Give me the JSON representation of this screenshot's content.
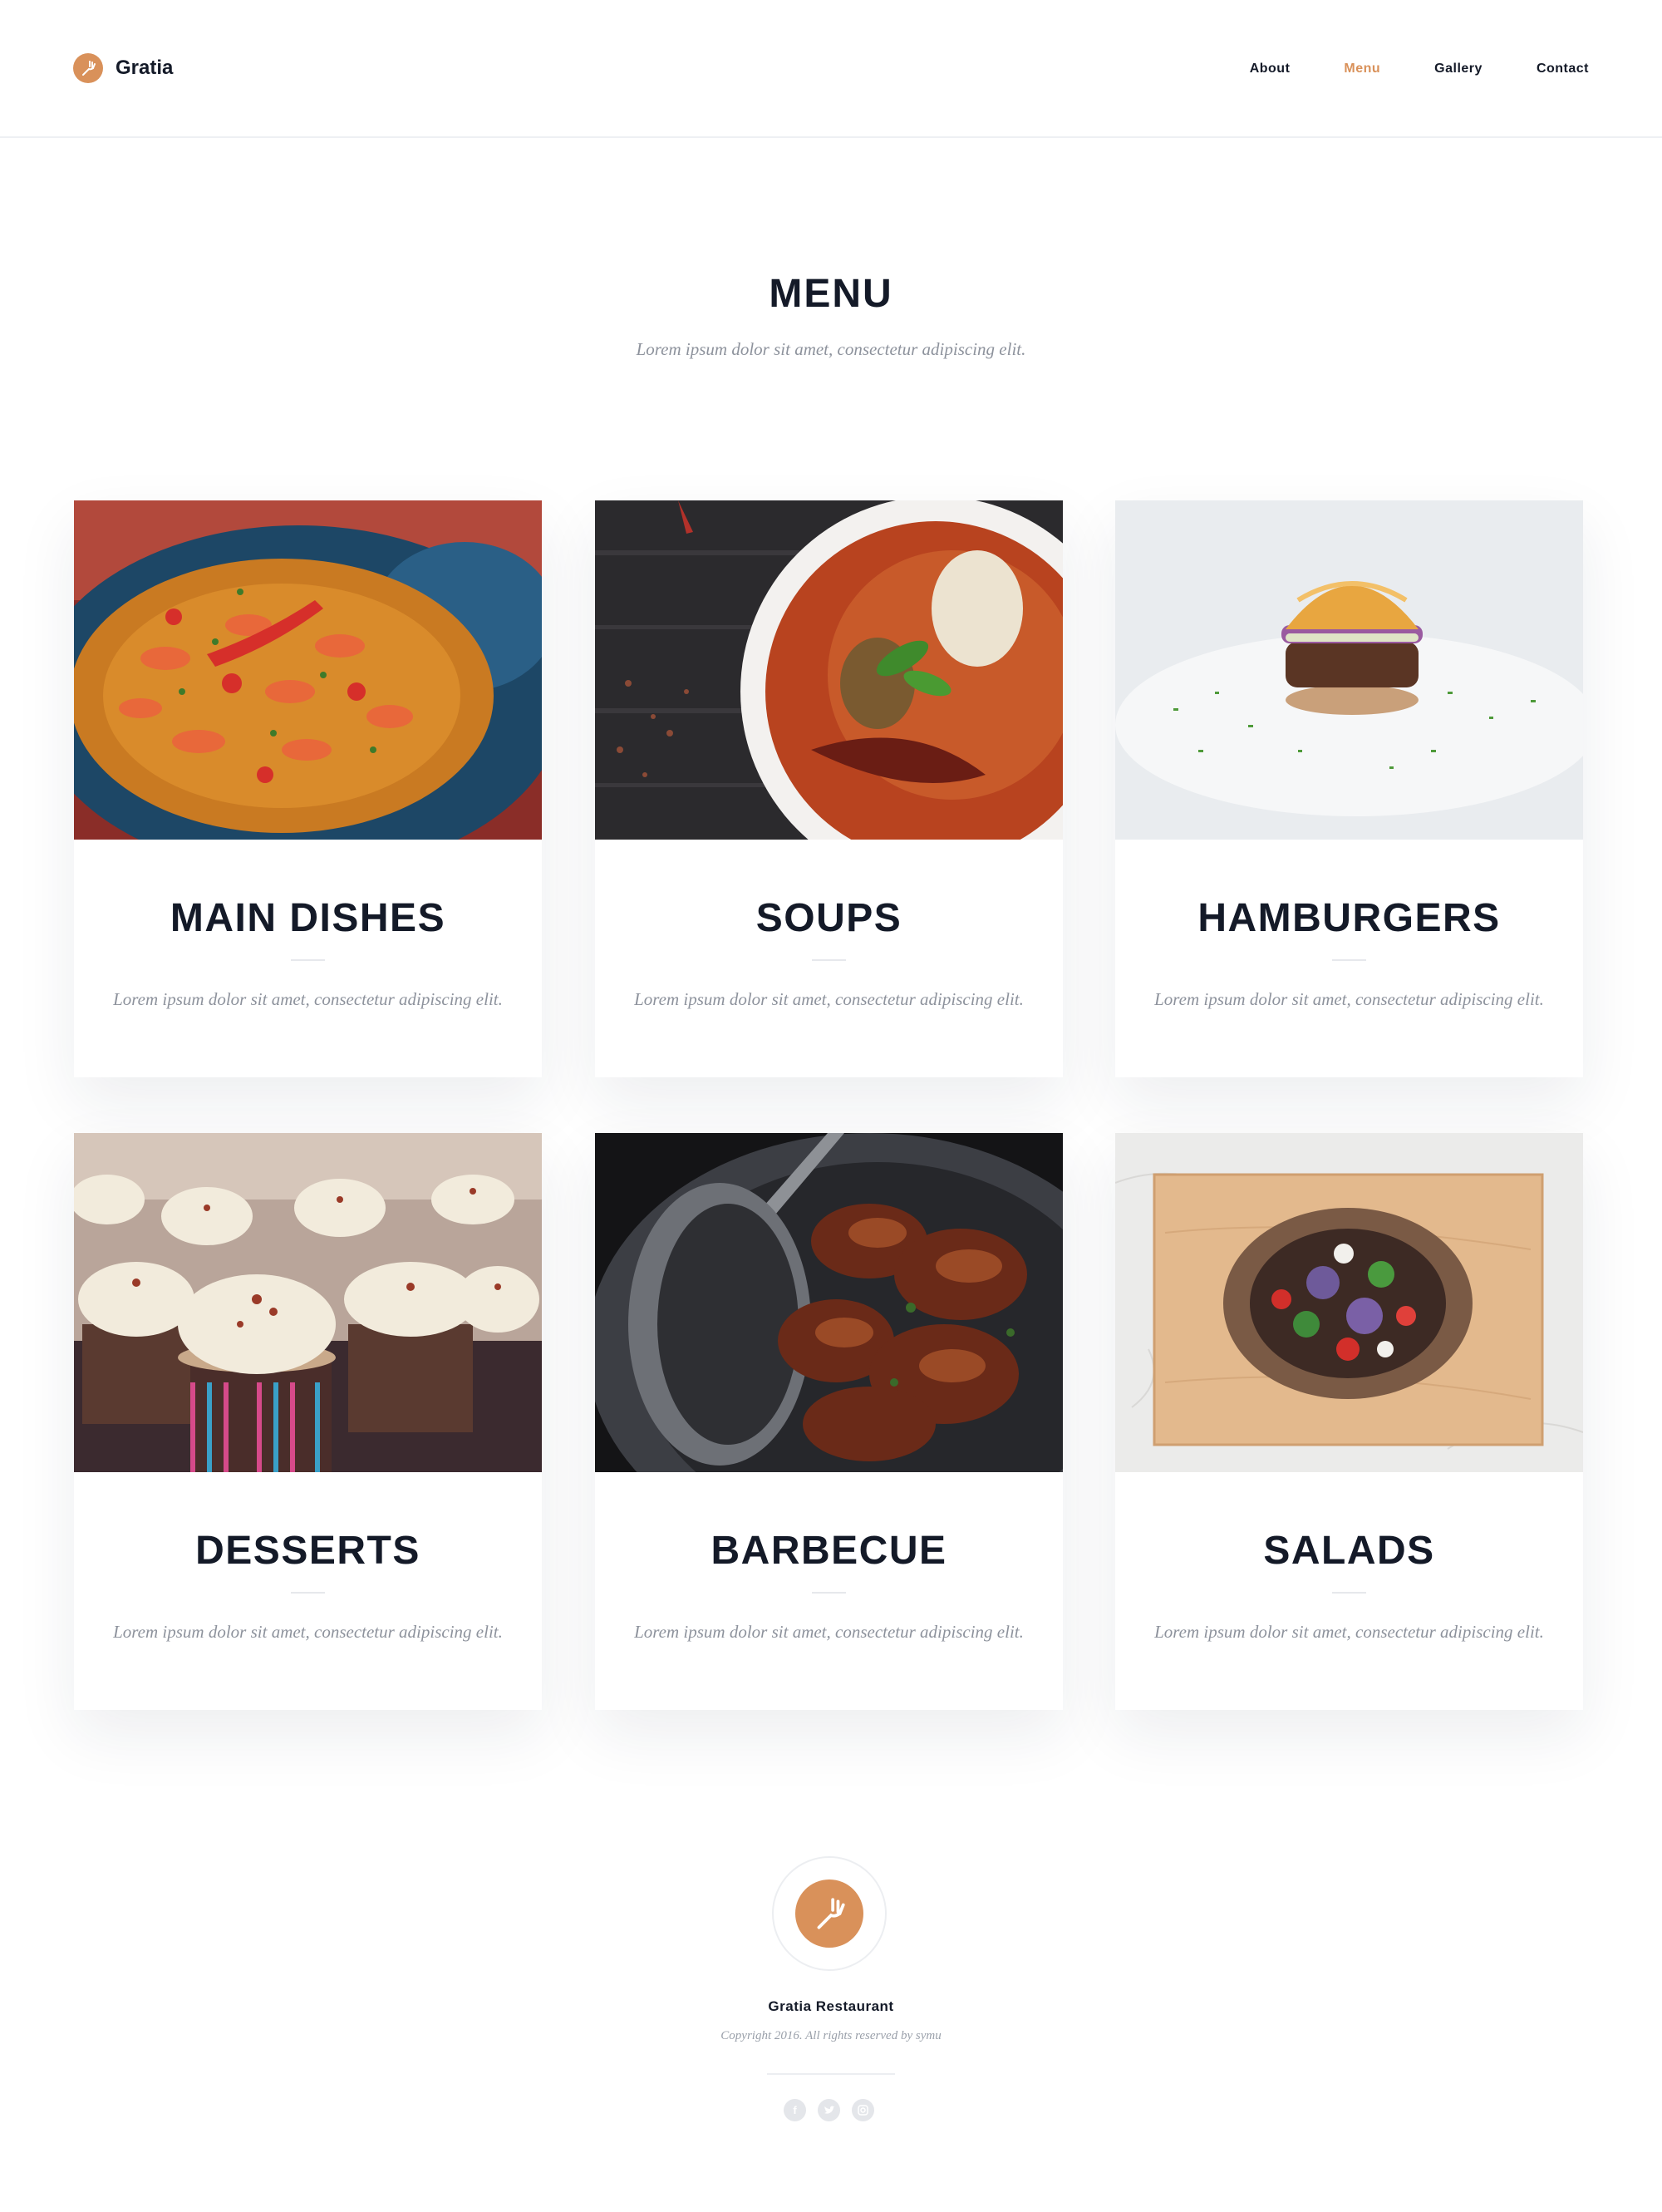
{
  "brand": {
    "name": "Gratia",
    "accent": "#d9915a",
    "logo_icon": "fork-icon"
  },
  "nav": {
    "items": [
      {
        "label": "About",
        "active": false
      },
      {
        "label": "Menu",
        "active": true
      },
      {
        "label": "Gallery",
        "active": false
      },
      {
        "label": "Contact",
        "active": false
      }
    ]
  },
  "section": {
    "title": "MENU",
    "subtitle": "Lorem ipsum dolor sit amet, consectetur adipiscing elit."
  },
  "cards": [
    {
      "title": "MAIN DISHES",
      "description": "Lorem ipsum dolor sit amet, consectetur adipiscing elit.",
      "image": "paella-photo"
    },
    {
      "title": "SOUPS",
      "description": "Lorem ipsum dolor sit amet, consectetur adipiscing elit.",
      "image": "soup-bowl-photo"
    },
    {
      "title": "HAMBURGERS",
      "description": "Lorem ipsum dolor sit amet, consectetur adipiscing elit.",
      "image": "burger-photo"
    },
    {
      "title": "DESSERTS",
      "description": "Lorem ipsum dolor sit amet, consectetur adipiscing elit.",
      "image": "cupcakes-photo"
    },
    {
      "title": "BARBECUE",
      "description": "Lorem ipsum dolor sit amet, consectetur adipiscing elit.",
      "image": "bbq-pan-photo"
    },
    {
      "title": "SALADS",
      "description": "Lorem ipsum dolor sit amet, consectetur adipiscing elit.",
      "image": "salad-bowl-photo"
    }
  ],
  "footer": {
    "name": "Gratia Restaurant",
    "copyright": "Copyright 2016. All rights reserved by symu",
    "socials": [
      "facebook-icon",
      "twitter-icon",
      "instagram-icon"
    ]
  }
}
